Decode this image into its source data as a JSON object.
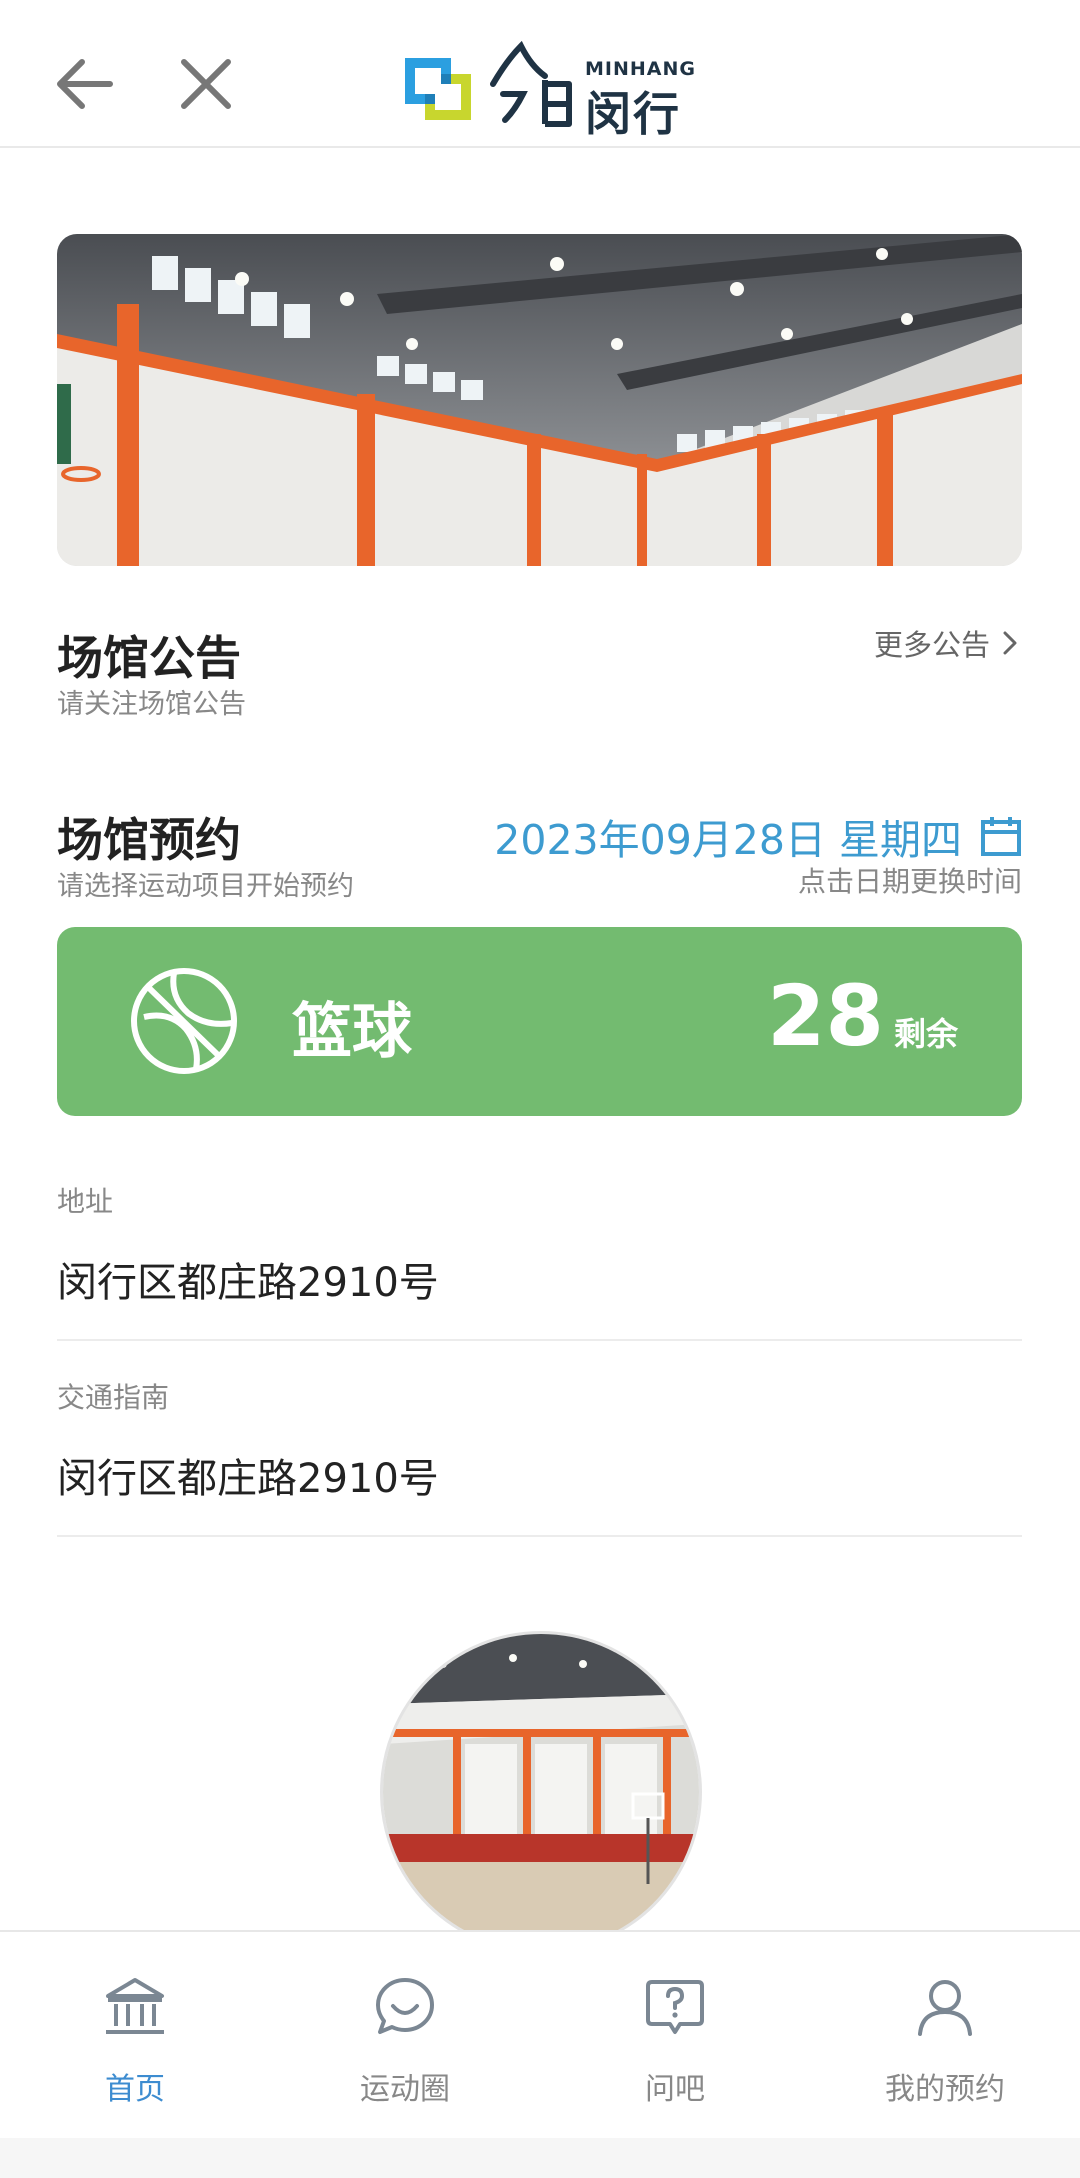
{
  "header": {
    "logo_sub": "MINHANG",
    "logo_cn": "闵行"
  },
  "announcement": {
    "title": "场馆公告",
    "subtitle": "请关注场馆公告",
    "more": "更多公告"
  },
  "booking": {
    "title": "场馆预约",
    "subtitle": "请选择运动项目开始预约",
    "date": "2023年09月28日 星期四",
    "date_hint": "点击日期更换时间"
  },
  "sport": {
    "name": "篮球",
    "count": "28",
    "remain_label": "剩余"
  },
  "info": {
    "address_label": "地址",
    "address_value": "闵行区都庄路2910号",
    "transport_label": "交通指南",
    "transport_value": "闵行区都庄路2910号"
  },
  "tabs": [
    {
      "label": "首页",
      "icon": "bank-icon",
      "active": true
    },
    {
      "label": "运动圈",
      "icon": "chat-bubble-icon",
      "active": false
    },
    {
      "label": "问吧",
      "icon": "question-icon",
      "active": false
    },
    {
      "label": "我的预约",
      "icon": "user-icon",
      "active": false
    }
  ],
  "colors": {
    "accent_blue": "#3d9bd0",
    "card_green": "#73bb70",
    "court_orange": "#e8652b"
  }
}
